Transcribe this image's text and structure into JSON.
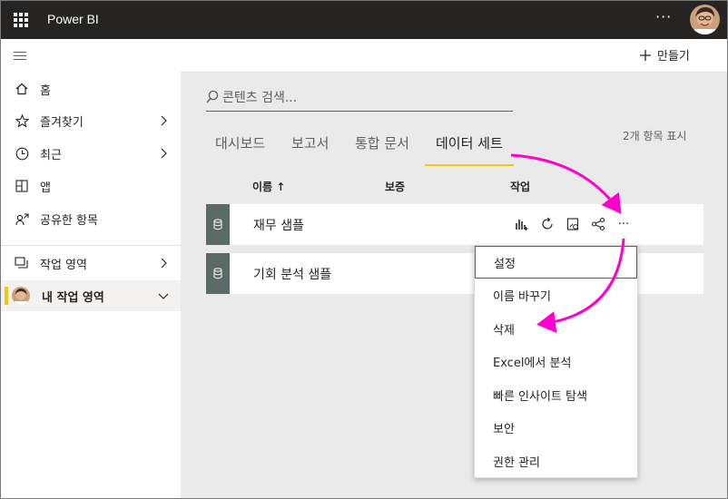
{
  "app": {
    "title": "Power BI",
    "more_label": "···"
  },
  "cmdbar": {
    "create_label": "만들기"
  },
  "sidebar": {
    "items": [
      {
        "label": "홈"
      },
      {
        "label": "즐겨찾기"
      },
      {
        "label": "최근"
      },
      {
        "label": "앱"
      },
      {
        "label": "공유한 항목"
      },
      {
        "label": "작업 영역"
      },
      {
        "label": "내 작업 영역"
      }
    ]
  },
  "search": {
    "placeholder": "콘텐츠 검색..."
  },
  "tabs": [
    "대시보드",
    "보고서",
    "통합 문서",
    "데이터 세트"
  ],
  "item_count": "2개 항목 표시",
  "columns": {
    "name": "이름 ↑",
    "endorsement": "보증",
    "actions": "작업"
  },
  "rows": [
    {
      "name": "재무 샘플"
    },
    {
      "name": "기회 분석 샘플"
    }
  ],
  "row_more": "···",
  "context_menu": {
    "items": [
      "설정",
      "이름 바꾸기",
      "삭제",
      "Excel에서 분석",
      "빠른 인사이트 탐색",
      "보안",
      "권한 관리"
    ]
  },
  "colors": {
    "accent": "#f2c811",
    "annotation": "#ff00cc",
    "topbar": "#252423",
    "dataset_stripe": "#5a6a66"
  },
  "icons": {
    "app_launcher": "waffle-icon",
    "dataset": "database-icon"
  }
}
